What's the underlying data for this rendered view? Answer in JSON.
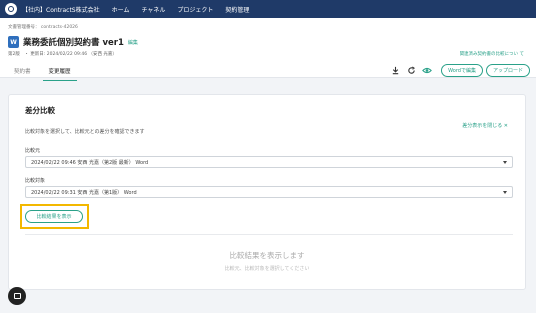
{
  "topbar": {
    "org": "【社内】ContractS株式会社",
    "nav": [
      "ホーム",
      "チャネル",
      "プロジェクト",
      "契約管理"
    ]
  },
  "doc": {
    "number": "文書管理番号： contracts-42026",
    "title": "業務委託個別契約書 ver1",
    "edit": "編集",
    "meta": "第2版　・ 更新日: 2024/02/22 09:46 （安西 光嘉）",
    "related": "関連済み契約書の比較につい て"
  },
  "tabs": [
    "契約書",
    "変更履歴"
  ],
  "toolbar": {
    "word_edit": "Wordで編集",
    "upload": "アップロード"
  },
  "diff": {
    "title": "差分比較",
    "description": "比較対象を選択して、比較元との差分を確認できます",
    "close": "差分表示を閉じる",
    "source_label": "比較元",
    "source_value": "2024/02/22 09:46 安西 光嘉（第2版 最新） Word",
    "target_label": "比較対象",
    "target_value": "2024/02/22 09:31 安西 光嘉（第1版） Word",
    "show_button": "比較結果を表示",
    "empty_title": "比較結果を表示します",
    "empty_sub": "比較元、比較対象を選択してください"
  },
  "colors": {
    "topbar": "#1f3a68",
    "accent": "#2aa189",
    "highlight": "#f3b800"
  }
}
